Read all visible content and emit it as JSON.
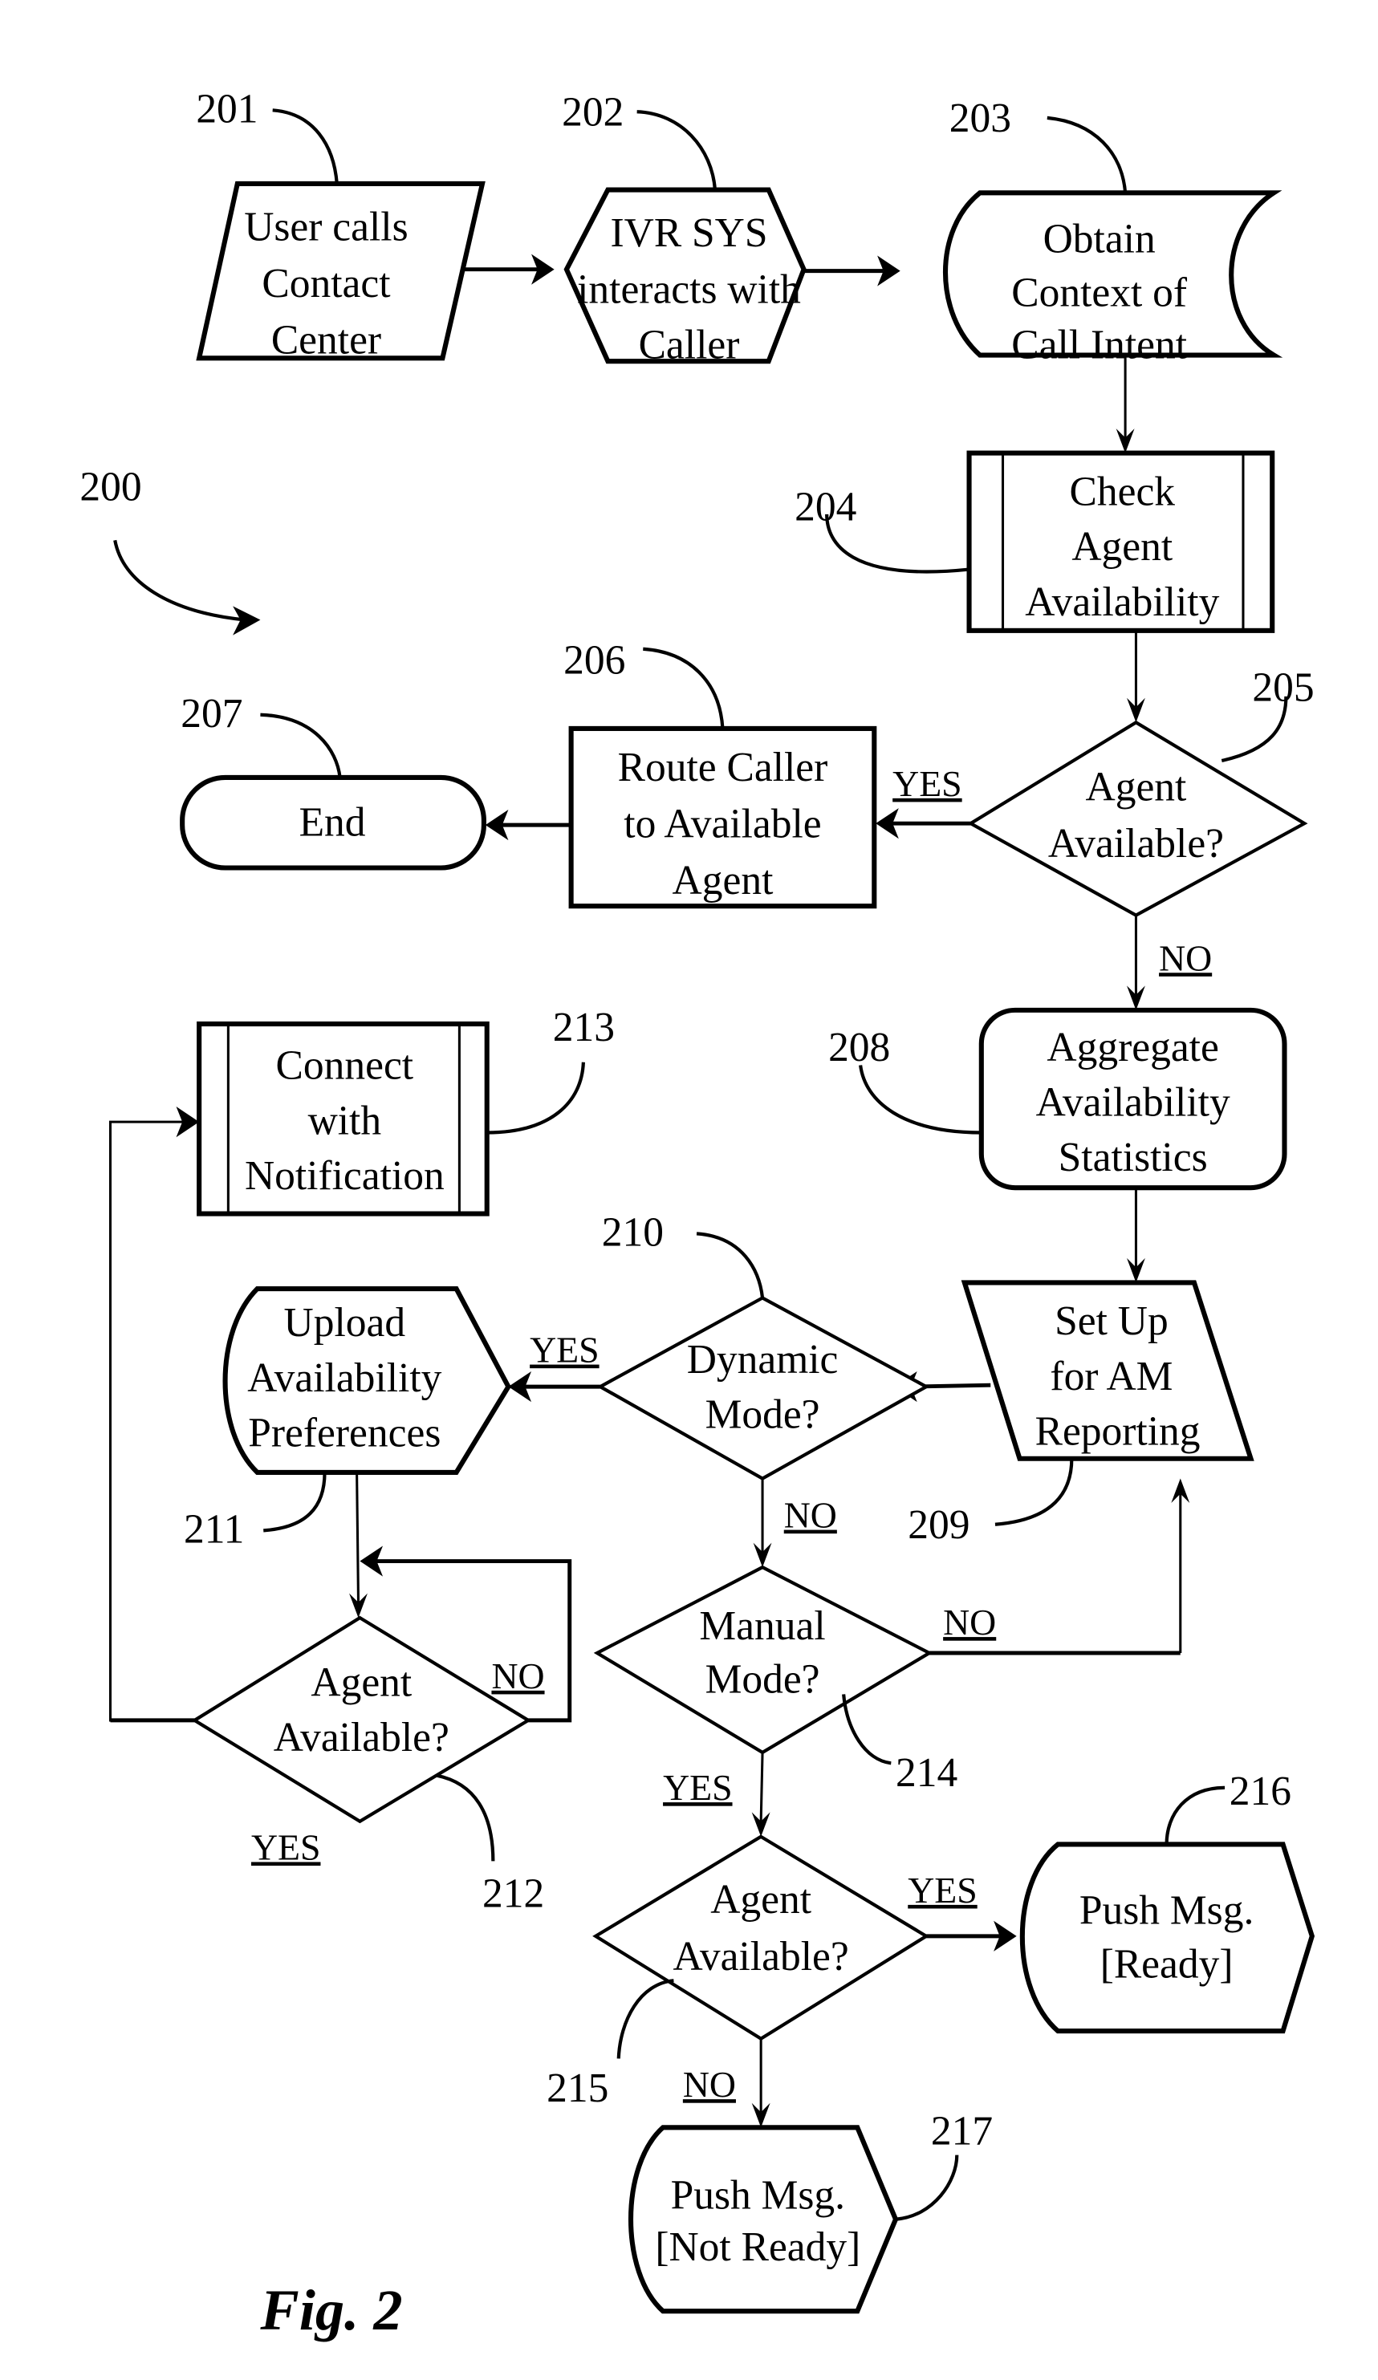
{
  "figure": {
    "caption": "Fig. 2",
    "reference": "200"
  },
  "nodes": {
    "n201": {
      "ref": "201",
      "shape": "parallelogram",
      "lines": [
        "User calls",
        "Contact",
        "Center"
      ]
    },
    "n202": {
      "ref": "202",
      "shape": "hexagon",
      "lines": [
        "IVR SYS",
        "interacts with",
        "Caller"
      ]
    },
    "n203": {
      "ref": "203",
      "shape": "stored-data",
      "lines": [
        "Obtain",
        "Context of",
        "Call Intent"
      ]
    },
    "n204": {
      "ref": "204",
      "shape": "predefined-process",
      "lines": [
        "Check",
        "Agent",
        "Availability"
      ]
    },
    "n205": {
      "ref": "205",
      "shape": "decision",
      "lines": [
        "Agent",
        "Available?"
      ]
    },
    "n206": {
      "ref": "206",
      "shape": "process",
      "lines": [
        "Route Caller",
        "to Available",
        "Agent"
      ]
    },
    "n207": {
      "ref": "207",
      "shape": "terminator",
      "lines": [
        "End"
      ]
    },
    "n208": {
      "ref": "208",
      "shape": "rounded-process",
      "lines": [
        "Aggregate",
        "Availability",
        "Statistics"
      ]
    },
    "n209": {
      "ref": "209",
      "shape": "parallelogram",
      "lines": [
        "Set Up",
        "for AM",
        "Reporting"
      ]
    },
    "n210": {
      "ref": "210",
      "shape": "decision",
      "lines": [
        "Dynamic",
        "Mode?"
      ]
    },
    "n211": {
      "ref": "211",
      "shape": "display",
      "lines": [
        "Upload",
        "Availability",
        "Preferences"
      ]
    },
    "n212": {
      "ref": "212",
      "shape": "decision",
      "lines": [
        "Agent",
        "Available?"
      ]
    },
    "n213": {
      "ref": "213",
      "shape": "predefined-process",
      "lines": [
        "Connect",
        "with",
        "Notification"
      ]
    },
    "n214": {
      "ref": "214",
      "shape": "decision",
      "lines": [
        "Manual",
        "Mode?"
      ]
    },
    "n215": {
      "ref": "215",
      "shape": "decision",
      "lines": [
        "Agent",
        "Available?"
      ]
    },
    "n216": {
      "ref": "216",
      "shape": "display",
      "lines": [
        "Push Msg.",
        "[Ready]"
      ]
    },
    "n217": {
      "ref": "217",
      "shape": "display",
      "lines": [
        "Push Msg.",
        "[Not Ready]"
      ]
    }
  },
  "edge_labels": {
    "e205_yes": "YES",
    "e205_no": "NO",
    "e210_yes": "YES",
    "e210_no": "NO",
    "e212_no": "NO",
    "e212_yes": "YES",
    "e214_no": "NO",
    "e214_yes": "YES",
    "e215_yes": "YES",
    "e215_no": "NO"
  },
  "edges": [
    {
      "from": "201",
      "to": "202"
    },
    {
      "from": "202",
      "to": "203"
    },
    {
      "from": "203",
      "to": "204"
    },
    {
      "from": "204",
      "to": "205"
    },
    {
      "from": "205",
      "to": "206",
      "label": "YES"
    },
    {
      "from": "206",
      "to": "207"
    },
    {
      "from": "205",
      "to": "208",
      "label": "NO"
    },
    {
      "from": "208",
      "to": "209"
    },
    {
      "from": "209",
      "to": "210"
    },
    {
      "from": "210",
      "to": "211",
      "label": "YES"
    },
    {
      "from": "210",
      "to": "214",
      "label": "NO"
    },
    {
      "from": "211",
      "to": "212"
    },
    {
      "from": "212",
      "to": "212",
      "label": "NO"
    },
    {
      "from": "212",
      "to": "213",
      "label": "YES"
    },
    {
      "from": "214",
      "to": "209",
      "label": "NO"
    },
    {
      "from": "214",
      "to": "215",
      "label": "YES"
    },
    {
      "from": "215",
      "to": "216",
      "label": "YES"
    },
    {
      "from": "215",
      "to": "217",
      "label": "NO"
    }
  ]
}
